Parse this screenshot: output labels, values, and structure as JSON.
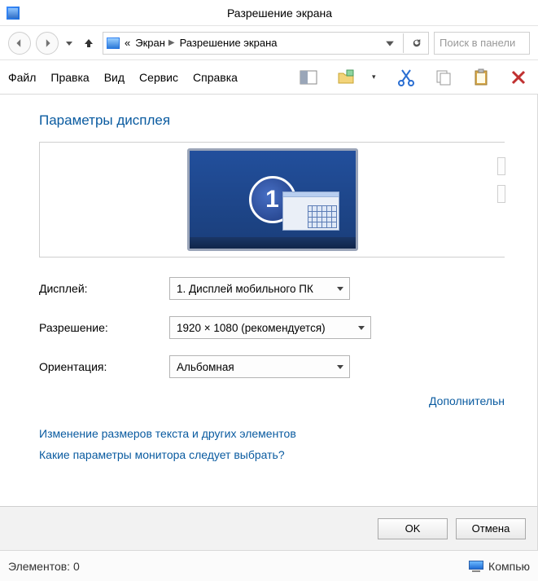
{
  "window": {
    "title": "Разрешение экрана"
  },
  "nav": {
    "crumbs": [
      "Экран",
      "Разрешение экрана"
    ],
    "quote": "«",
    "searchPlaceholder": "Поиск в панели"
  },
  "menu": {
    "file": "Файл",
    "edit": "Правка",
    "view": "Вид",
    "service": "Сервис",
    "help": "Справка"
  },
  "page": {
    "heading": "Параметры дисплея",
    "displayNumber": "1",
    "labels": {
      "display": "Дисплей:",
      "resolution": "Разрешение:",
      "orientation": "Ориентация:"
    },
    "values": {
      "display": "1. Дисплей мобильного ПК",
      "resolution": "1920 × 1080 (рекомендуется)",
      "orientation": "Альбомная"
    },
    "links": {
      "additional": "Дополнительн",
      "textScaling": "Изменение размеров текста и других элементов",
      "help": "Какие параметры монитора следует выбрать?"
    },
    "buttons": {
      "ok": "OK",
      "cancel": "Отмена"
    }
  },
  "status": {
    "items": "Элементов: 0",
    "computer": "Компью"
  }
}
